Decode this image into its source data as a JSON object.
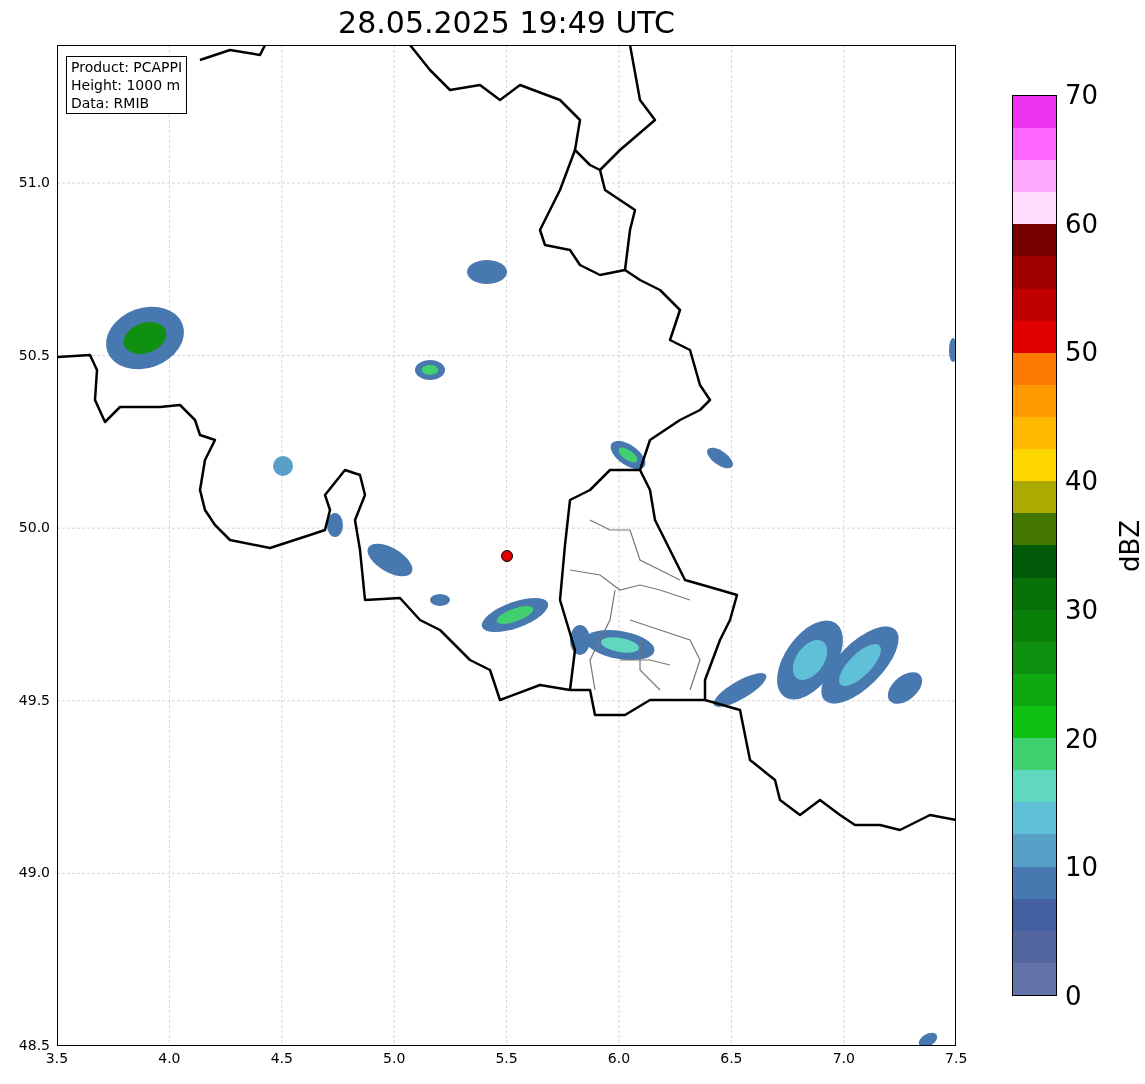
{
  "title": "28.05.2025 19:49 UTC",
  "info_box": [
    "Product: PCAPPI",
    "Height: 1000 m",
    "Data: RMIB"
  ],
  "map": {
    "x_ticks": [
      "3.5",
      "4.0",
      "4.5",
      "5.0",
      "5.5",
      "6.0",
      "6.5",
      "7.0",
      "7.5"
    ],
    "y_ticks": [
      "51.0",
      "50.5",
      "50.0",
      "49.5",
      "49.0",
      "48.5"
    ]
  },
  "colorbar": {
    "label": "dBZ",
    "ticks": [
      "70",
      "60",
      "50",
      "40",
      "30",
      "20",
      "10",
      "0"
    ],
    "segments": [
      {
        "color": "#6474a8"
      },
      {
        "color": "#5466a0"
      },
      {
        "color": "#4460a0"
      },
      {
        "color": "#4878b0"
      },
      {
        "color": "#58a0c8"
      },
      {
        "color": "#60c0d8"
      },
      {
        "color": "#60d8c0"
      },
      {
        "color": "#40d070"
      },
      {
        "color": "#10c010"
      },
      {
        "color": "#10a810"
      },
      {
        "color": "#109010"
      },
      {
        "color": "#0a800a"
      },
      {
        "color": "#087008"
      },
      {
        "color": "#005a08"
      },
      {
        "color": "#447700"
      },
      {
        "color": "#aaaa00"
      },
      {
        "color": "#ffd700"
      },
      {
        "color": "#ffb800"
      },
      {
        "color": "#ff9a00"
      },
      {
        "color": "#ff7a00"
      },
      {
        "color": "#e00000"
      },
      {
        "color": "#c00000"
      },
      {
        "color": "#a00000"
      },
      {
        "color": "#770000"
      },
      {
        "color": "#ffddff"
      },
      {
        "color": "#ffaaff"
      },
      {
        "color": "#ff66ff"
      },
      {
        "color": "#ee33ee"
      }
    ]
  }
}
